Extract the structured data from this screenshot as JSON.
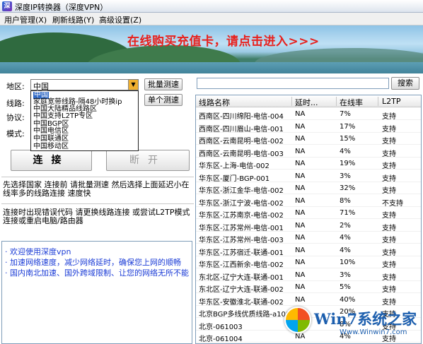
{
  "window": {
    "title": "深度IP转换器（深度VPN）"
  },
  "menu": [
    {
      "label": "用户管理(X)"
    },
    {
      "label": "刷新线路(Y)"
    },
    {
      "label": "高级设置(Z)"
    }
  ],
  "banner": {
    "slogan": "在线购买充值卡，请点击进入>>>"
  },
  "controls": {
    "region_label": "地区:",
    "region_value": "中国",
    "line_label": "线路:",
    "protocol_label": "协议:",
    "mode_label": "模式:",
    "batch_test": "批量测速",
    "single_test": "单个测速",
    "connect": "连接",
    "disconnect": "断开"
  },
  "dropdown_options": [
    "中国",
    "家庭宽带线路-隔48小时换ip",
    "中国大陆精品线路区",
    "中国支持L2TP专区",
    "中国BGP区",
    "中国电信区",
    "中国联通区",
    "中国移动区"
  ],
  "hints": {
    "hint1": "先选择国家 连接前 请批量测速 然后选择上面延迟小在线率多的线路连接 速度快",
    "hint2": "连接时出现错误代码 请更换线路连接 或尝试L2TP模式连接或重启电脑/路由器"
  },
  "news": [
    "· 欢迎使用深度vpn",
    "· 加速网络速度，减少网络延时，确保您上网的顺畅",
    "· 国内南北加速、国外跨域限制、让您的网络无所不能"
  ],
  "search": {
    "label": "搜索",
    "value": ""
  },
  "table": {
    "columns": [
      "线路名称",
      "延时...",
      "在线率",
      "L2TP"
    ],
    "rows": [
      [
        "西南区-四川绵阳-电信-004",
        "NA",
        "7%",
        "支持"
      ],
      [
        "西南区-四川眉山-电信-001",
        "NA",
        "17%",
        "支持"
      ],
      [
        "西南区-云南昆明-电信-002",
        "NA",
        "15%",
        "支持"
      ],
      [
        "西南区-云南昆明-电信-003",
        "NA",
        "4%",
        "支持"
      ],
      [
        "华东区-上海-电信-002",
        "NA",
        "19%",
        "支持"
      ],
      [
        "华东区-厦门-BGP-001",
        "NA",
        "3%",
        "支持"
      ],
      [
        "华东区-浙江金华-电信-002",
        "NA",
        "32%",
        "支持"
      ],
      [
        "华东区-浙江宁波-电信-002",
        "NA",
        "8%",
        "不支持"
      ],
      [
        "华东区-江苏南京-电信-002",
        "NA",
        "71%",
        "支持"
      ],
      [
        "华东区-江苏常州-电信-001",
        "NA",
        "2%",
        "支持"
      ],
      [
        "华东区-江苏常州-电信-003",
        "NA",
        "4%",
        "支持"
      ],
      [
        "华东区-江苏宿迁-联通-001",
        "NA",
        "4%",
        "支持"
      ],
      [
        "华东区-江西新余-电信-002",
        "NA",
        "10%",
        "支持"
      ],
      [
        "东北区-辽宁大连-联通-001",
        "NA",
        "3%",
        "支持"
      ],
      [
        "东北区-辽宁大连-联通-002",
        "NA",
        "5%",
        "支持"
      ],
      [
        "华东区-安徽淮北-联通-002",
        "NA",
        "40%",
        "支持"
      ],
      [
        "北京BGP多线优质线路-a100",
        "NA",
        "20%",
        "支持"
      ],
      [
        "北京-061003",
        "NA",
        "8%",
        "支持"
      ],
      [
        "北京-061004",
        "NA",
        "4%",
        "支持"
      ]
    ]
  },
  "watermark": {
    "brand": "Win7系统之家",
    "url": "Www.Winwin7.com"
  }
}
